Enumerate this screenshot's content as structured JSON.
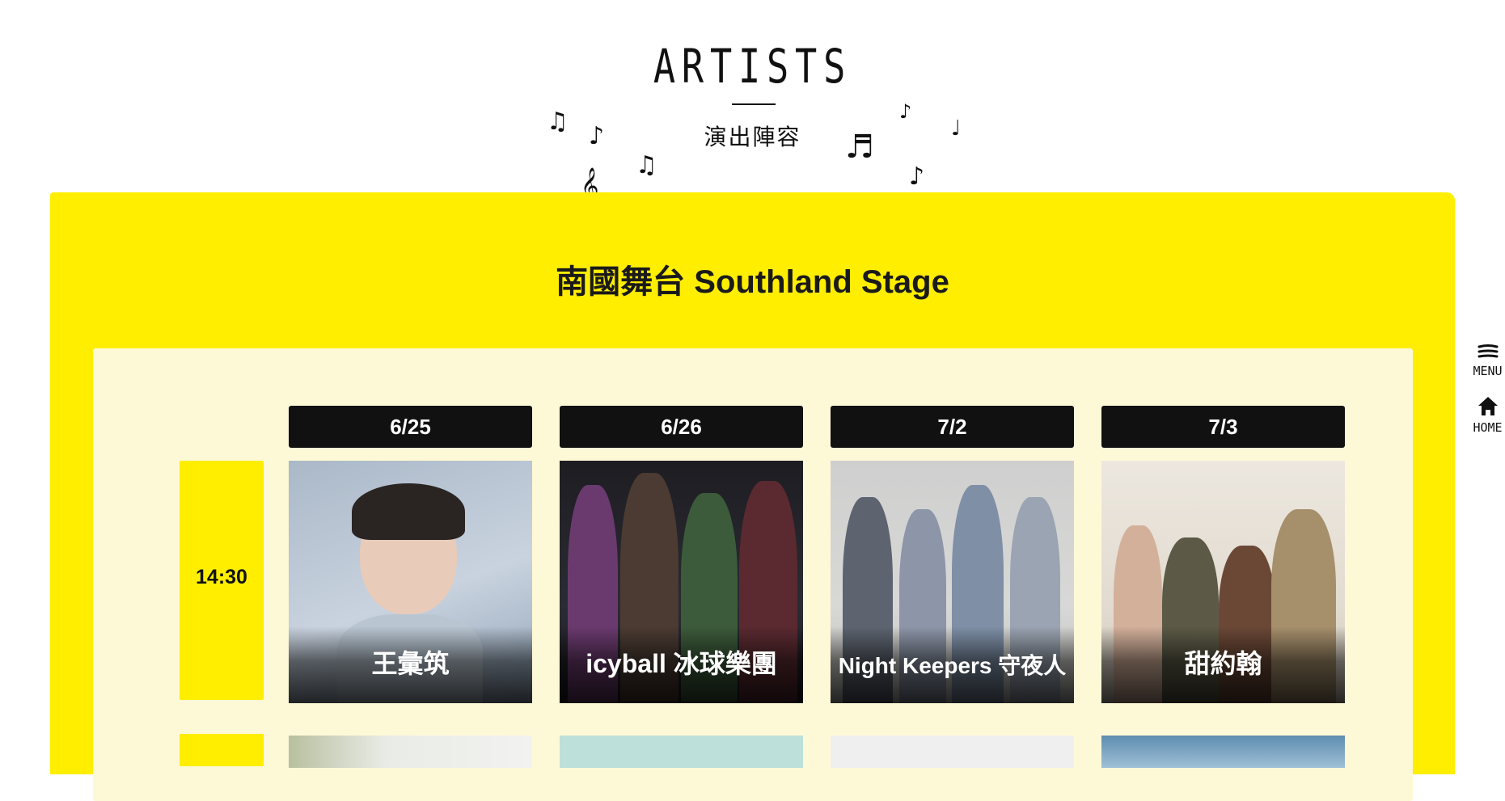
{
  "header": {
    "title": "ARTISTS",
    "subtitle": "演出陣容"
  },
  "stage": {
    "title": "南國舞台 Southland Stage"
  },
  "dates": [
    "6/25",
    "6/26",
    "7/2",
    "7/3"
  ],
  "time_slots": [
    "14:30"
  ],
  "artists": [
    {
      "name": "王彙筑",
      "date": "6/25"
    },
    {
      "name": "icyball 冰球樂團",
      "date": "6/26"
    },
    {
      "name": "Night Keepers 守夜人",
      "date": "7/2"
    },
    {
      "name": "甜約翰",
      "date": "7/3"
    }
  ],
  "side_nav": {
    "menu_label": "MENU",
    "home_label": "HOME"
  },
  "icons": {
    "menu": "menu-icon",
    "home": "home-icon",
    "notes": "music-note-icon"
  },
  "colors": {
    "board_yellow": "#ffee00",
    "panel_cream": "#fdf9d6",
    "tab_black": "#111111"
  }
}
